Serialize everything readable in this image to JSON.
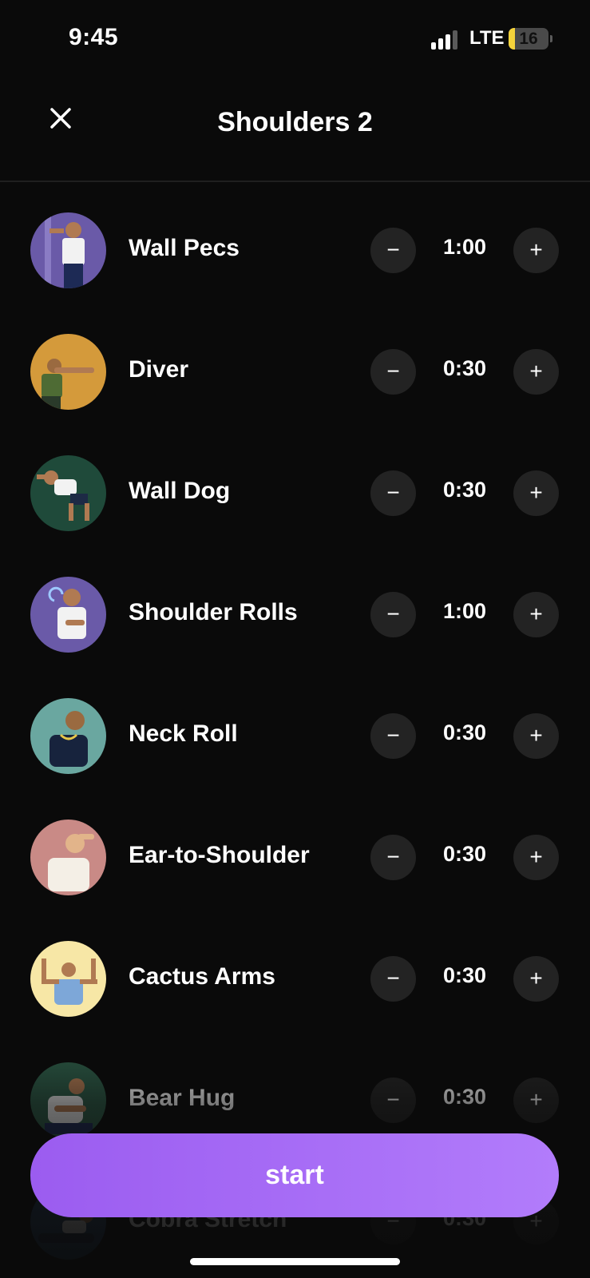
{
  "status_bar": {
    "time": "9:45",
    "carrier": "LTE",
    "battery": "16",
    "battery_level": 0.16
  },
  "header": {
    "title": "Shoulders 2"
  },
  "exercises": [
    {
      "name": "Wall Pecs",
      "duration": "1:00",
      "bg": "#6a5aa8",
      "icon": "wall-pecs-illustration"
    },
    {
      "name": "Diver",
      "duration": "0:30",
      "bg": "#d49a3b",
      "icon": "diver-illustration"
    },
    {
      "name": "Wall Dog",
      "duration": "0:30",
      "bg": "#1f4a3a",
      "icon": "wall-dog-illustration"
    },
    {
      "name": "Shoulder Rolls",
      "duration": "1:00",
      "bg": "#6a5aa8",
      "icon": "shoulder-rolls-illustration"
    },
    {
      "name": "Neck Roll",
      "duration": "0:30",
      "bg": "#6aa7a0",
      "icon": "neck-roll-illustration"
    },
    {
      "name": "Ear-to-Shoulder",
      "duration": "0:30",
      "bg": "#c98a86",
      "icon": "ear-to-shoulder-illustration"
    },
    {
      "name": "Cactus Arms",
      "duration": "0:30",
      "bg": "#f7e7a6",
      "icon": "cactus-arms-illustration"
    },
    {
      "name": "Bear Hug",
      "duration": "0:30",
      "bg": "#2c5a46",
      "icon": "bear-hug-illustration"
    },
    {
      "name": "Cobra Stretch",
      "duration": "0:30",
      "bg": "#27476a",
      "icon": "cobra-stretch-illustration"
    }
  ],
  "controls": {
    "minus": "−",
    "plus": "+"
  },
  "start_label": "start",
  "colors": {
    "background": "#0a0a0a",
    "button_dark": "#232323",
    "accent_start": "#9b5cf0",
    "accent_end": "#b27cfb"
  }
}
